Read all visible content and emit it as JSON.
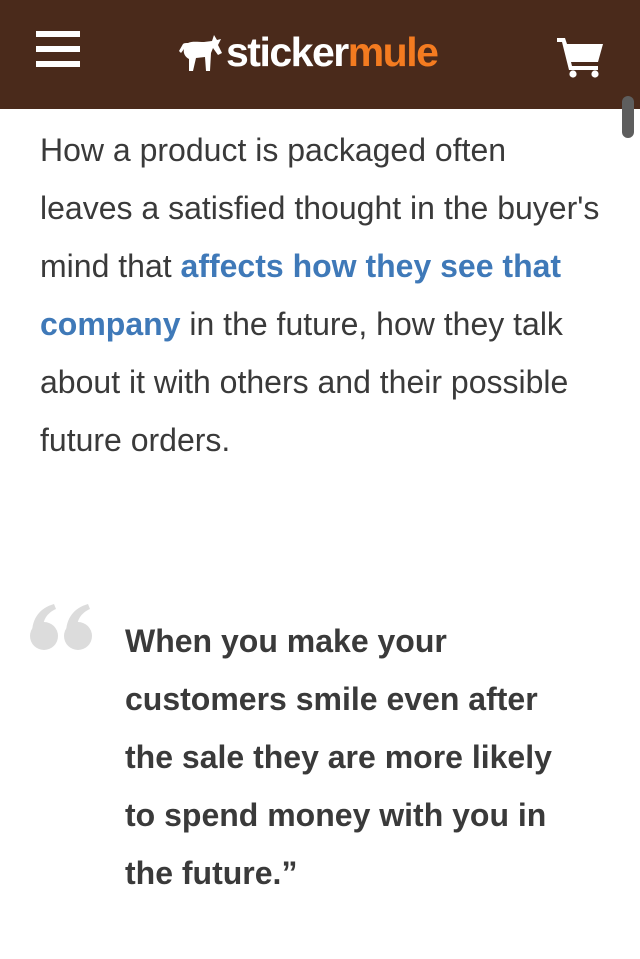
{
  "header": {
    "logo_part1": "sticker",
    "logo_part2": "mule",
    "background_color": "#4a2a1b",
    "accent_color": "#f47b20",
    "menu_icon": "hamburger-menu-icon",
    "cart_icon": "cart-icon",
    "logo_icon": "mule-icon"
  },
  "article": {
    "intro_before_link": "How a product is packaged often leaves a satisfied thought in the buyer's mind that ",
    "intro_link": "affects how they see that company",
    "intro_after_link": " in the future, how they talk about it with others and their possible future orders.",
    "link_color": "#3f79b8",
    "quote_icon": "quote-icon",
    "quote": "When you make your customers smile even after the sale they are more likely to spend money with you in the future.”"
  }
}
